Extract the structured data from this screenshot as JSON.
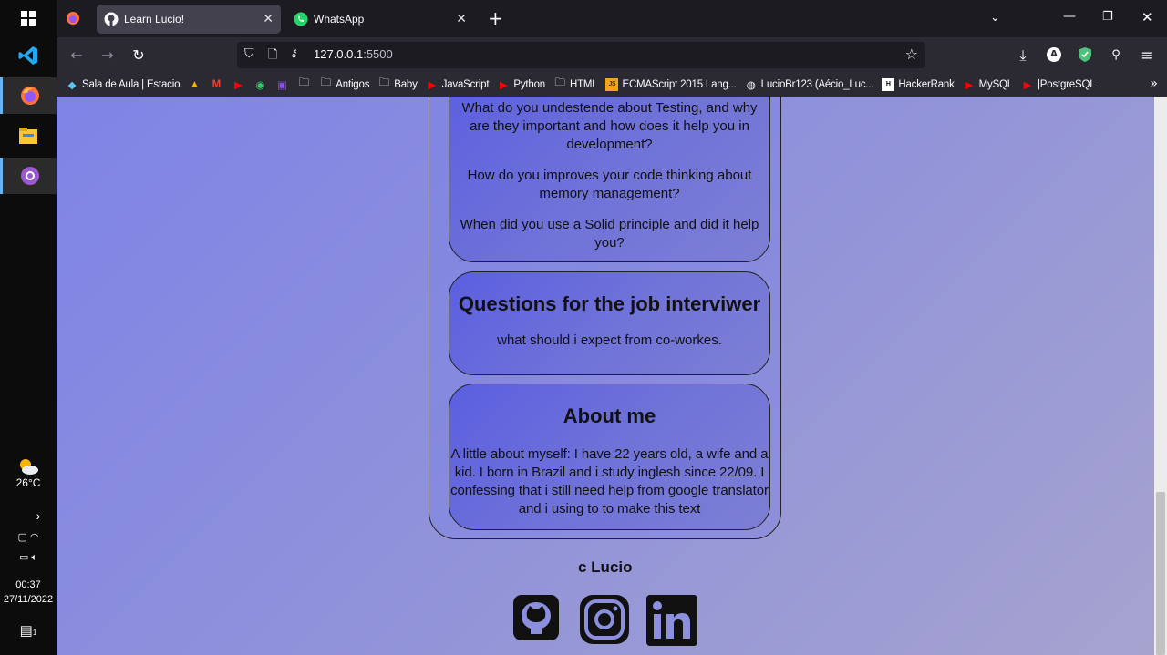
{
  "taskbar": {
    "weather_temp": "26°C",
    "time": "00:37",
    "date": "27/11/2022",
    "notification_count": "1"
  },
  "browser": {
    "tabs": [
      {
        "label": "Learn Lucio!",
        "active": true
      },
      {
        "label": "WhatsApp",
        "active": false
      }
    ],
    "url_host": "127.0.0.1",
    "url_port": ":5500",
    "bookmarks": [
      "Sala de Aula | Estacio",
      "Antigos",
      "Baby",
      "JavaScript",
      "Python",
      "HTML",
      "ECMAScript 2015 Lang...",
      "LucioBr123 (Aécio_Luc...",
      "HackerRank",
      "MySQL",
      "|PostgreSQL"
    ]
  },
  "page": {
    "card1": {
      "questions": [
        "What do you undestende about Testing, and why are they important and how does it help you in development?",
        "How do you improves your code thinking about memory management?",
        "When did you use a Solid principle and did it help you?"
      ]
    },
    "card2": {
      "title": "Questions for the job interviwer",
      "text": "what should i expect from co-workes."
    },
    "card3": {
      "title": "About me",
      "text": "A little about myself: I have 22 years old, a wife and a kid. I born in Brazil and i study inglesh since 22/09. I confessing that i still need help from google translator and i using to to make this text"
    },
    "footer": {
      "copyright": "c Lucio",
      "social": [
        "github-icon",
        "instagram-icon",
        "linkedin-icon"
      ]
    }
  },
  "colors": {
    "page_gradient_start": "#7f83e6",
    "card_fill": "#6f72d8",
    "firefox_toolbar": "#2b2a33"
  }
}
